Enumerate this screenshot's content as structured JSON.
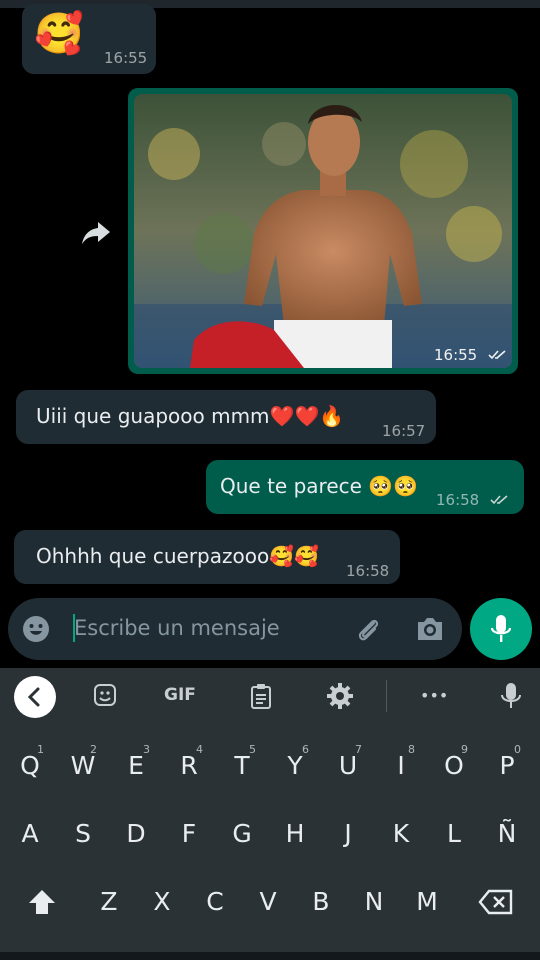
{
  "chat": {
    "messages": [
      {
        "from": "in",
        "text": "🥰",
        "time": "16:55"
      },
      {
        "from": "out",
        "type": "image",
        "time": "16:55"
      },
      {
        "from": "in",
        "text": "Uiii que guapooo mmm❤️❤️🔥",
        "time": "16:57"
      },
      {
        "from": "out",
        "text": "Que te parece 🥺🥺",
        "time": "16:58"
      },
      {
        "from": "in",
        "text": "Ohhhh que cuerpazooo🥰🥰",
        "time": "16:58"
      }
    ]
  },
  "composer": {
    "placeholder": "Escribe un mensaje"
  },
  "keyboard": {
    "toolbar": {
      "gif_label": "GIF",
      "more": "•••"
    },
    "row1": [
      {
        "k": "Q",
        "n": "1"
      },
      {
        "k": "W",
        "n": "2"
      },
      {
        "k": "E",
        "n": "3"
      },
      {
        "k": "R",
        "n": "4"
      },
      {
        "k": "T",
        "n": "5"
      },
      {
        "k": "Y",
        "n": "6"
      },
      {
        "k": "U",
        "n": "7"
      },
      {
        "k": "I",
        "n": "8"
      },
      {
        "k": "O",
        "n": "9"
      },
      {
        "k": "P",
        "n": "0"
      }
    ],
    "row2": [
      "A",
      "S",
      "D",
      "F",
      "G",
      "H",
      "J",
      "K",
      "L",
      "Ñ"
    ],
    "row3": [
      "Z",
      "X",
      "C",
      "V",
      "B",
      "N",
      "M"
    ]
  },
  "colors": {
    "incoming": "#202c33",
    "outgoing": "#005c4b",
    "accent": "#00a884",
    "background": "#000000"
  },
  "icons": [
    "smiley-icon",
    "attach-icon",
    "camera-icon",
    "mic-icon",
    "forward-icon",
    "back-icon",
    "sticker-icon",
    "clipboard-icon",
    "settings-icon",
    "shift-icon",
    "backspace-icon"
  ]
}
